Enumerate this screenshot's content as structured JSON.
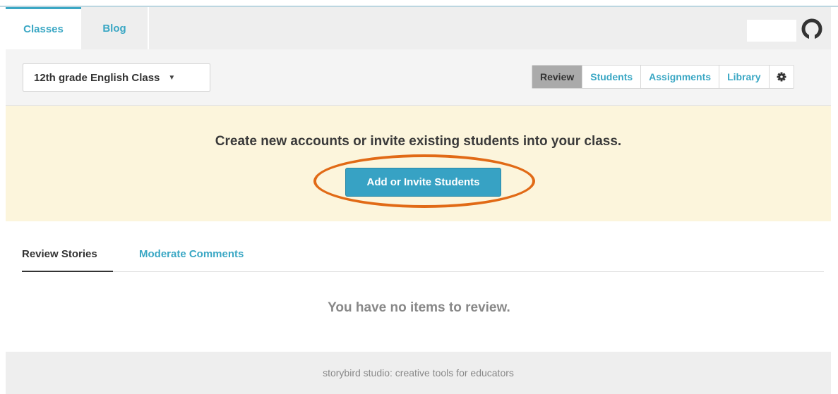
{
  "topnav": {
    "tabs": [
      {
        "label": "Classes",
        "active": true
      },
      {
        "label": "Blog",
        "active": false
      }
    ],
    "user_icon": "user-avatar-icon"
  },
  "class_bar": {
    "selected_class": "12th grade English Class",
    "caret_icon": "caret-down-icon",
    "nav": [
      {
        "label": "Review",
        "active": true
      },
      {
        "label": "Students",
        "active": false
      },
      {
        "label": "Assignments",
        "active": false
      },
      {
        "label": "Library",
        "active": false
      }
    ],
    "settings_icon": "gear-icon"
  },
  "banner": {
    "message": "Create new accounts or invite existing students into your class.",
    "button_label": "Add or Invite Students"
  },
  "subtabs": {
    "items": [
      {
        "label": "Review Stories",
        "active": true
      },
      {
        "label": "Moderate Comments",
        "active": false
      }
    ]
  },
  "empty_state": {
    "message": "You have no items to review."
  },
  "footer": {
    "text": "storybird studio: creative tools for educators"
  },
  "colors": {
    "accent": "#3aa7c4",
    "button": "#37a2c4",
    "banner_bg": "#fcf5dc",
    "highlight": "#e16a16",
    "active_nav": "#aaaaaa"
  }
}
